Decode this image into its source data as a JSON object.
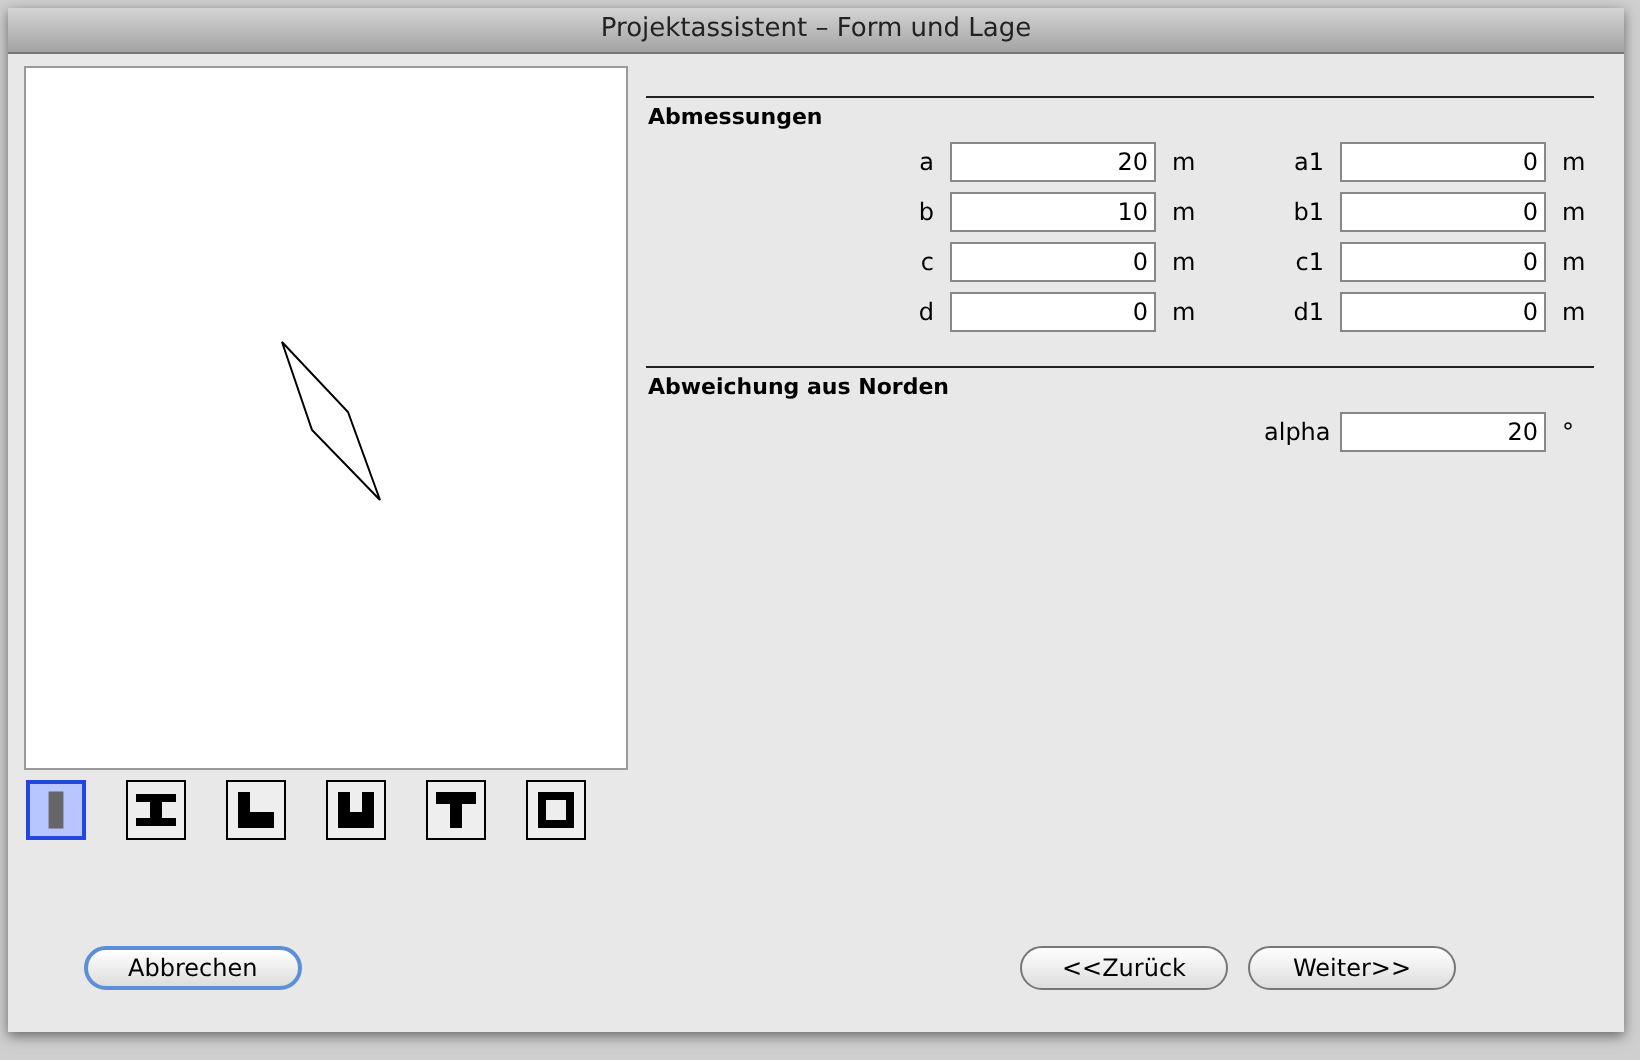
{
  "window": {
    "title": "Projektassistent – Form und Lage"
  },
  "shapes": [
    {
      "kind": "bar",
      "selected": true
    },
    {
      "kind": "i",
      "selected": false
    },
    {
      "kind": "l",
      "selected": false
    },
    {
      "kind": "u",
      "selected": false
    },
    {
      "kind": "t",
      "selected": false
    },
    {
      "kind": "o",
      "selected": false
    }
  ],
  "dimensions": {
    "title": "Abmessungen",
    "rows": [
      {
        "label": "a",
        "value": "20",
        "unit": "m",
        "label2": "a1",
        "value2": "0",
        "unit2": "m"
      },
      {
        "label": "b",
        "value": "10",
        "unit": "m",
        "label2": "b1",
        "value2": "0",
        "unit2": "m"
      },
      {
        "label": "c",
        "value": "0",
        "unit": "m",
        "label2": "c1",
        "value2": "0",
        "unit2": "m"
      },
      {
        "label": "d",
        "value": "0",
        "unit": "m",
        "label2": "d1",
        "value2": "0",
        "unit2": "m"
      }
    ]
  },
  "north": {
    "title": "Abweichung aus Norden",
    "label": "alpha",
    "value": "20",
    "unit": "°"
  },
  "buttons": {
    "cancel": "Abbrechen",
    "back": "<<Zurück",
    "next": "Weiter>>"
  }
}
